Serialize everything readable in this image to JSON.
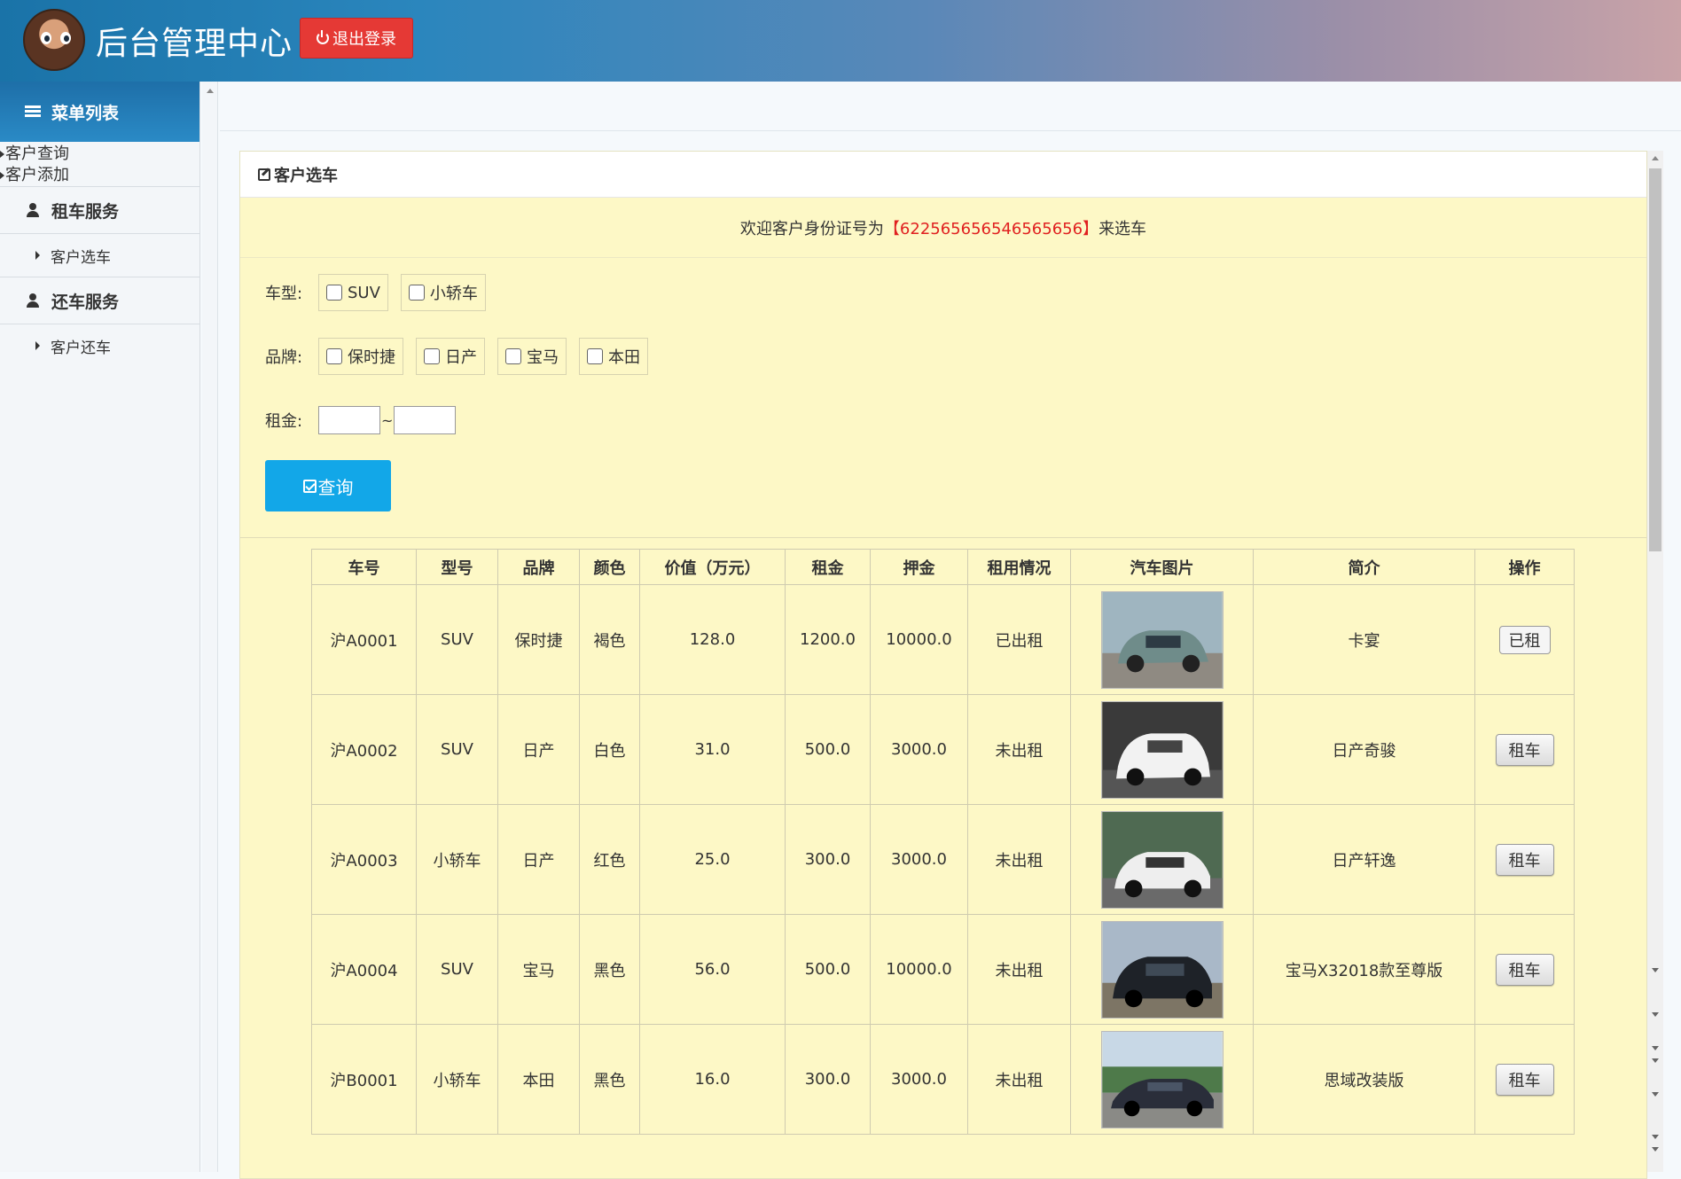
{
  "header": {
    "title": "后台管理中心",
    "logout_label": "退出登录"
  },
  "sidebar": {
    "menu_title": "菜单列表",
    "top_links": [
      "客户查询",
      "客户添加"
    ],
    "groups": [
      {
        "title": "租车服务",
        "items": [
          "客户选车"
        ]
      },
      {
        "title": "还车服务",
        "items": [
          "客户还车"
        ]
      }
    ]
  },
  "panel": {
    "title": "客户选车",
    "welcome_prefix": "欢迎客户身份证号为",
    "welcome_id": "【622565656546565656】",
    "welcome_suffix": "来选车"
  },
  "filters": {
    "type_label": "车型:",
    "types": [
      "SUV",
      "小轿车"
    ],
    "brand_label": "品牌:",
    "brands": [
      "保时捷",
      "日产",
      "宝马",
      "本田"
    ],
    "rent_label": "租金:",
    "rent_sep": "~",
    "query_label": "查询"
  },
  "table": {
    "headers": [
      "车号",
      "型号",
      "品牌",
      "颜色",
      "价值（万元）",
      "租金",
      "押金",
      "租用情况",
      "汽车图片",
      "简介",
      "操作"
    ],
    "rows": [
      {
        "no": "沪A0001",
        "model": "SUV",
        "brand": "保时捷",
        "color": "褐色",
        "value": "128.0",
        "rent": "1200.0",
        "deposit": "10000.0",
        "status": "已出租",
        "intro": "卡宴",
        "action": "已租"
      },
      {
        "no": "沪A0002",
        "model": "SUV",
        "brand": "日产",
        "color": "白色",
        "value": "31.0",
        "rent": "500.0",
        "deposit": "3000.0",
        "status": "未出租",
        "intro": "日产奇骏",
        "action": "租车"
      },
      {
        "no": "沪A0003",
        "model": "小轿车",
        "brand": "日产",
        "color": "红色",
        "value": "25.0",
        "rent": "300.0",
        "deposit": "3000.0",
        "status": "未出租",
        "intro": "日产轩逸",
        "action": "租车"
      },
      {
        "no": "沪A0004",
        "model": "SUV",
        "brand": "宝马",
        "color": "黑色",
        "value": "56.0",
        "rent": "500.0",
        "deposit": "10000.0",
        "status": "未出租",
        "intro": "宝马X32018款至尊版",
        "action": "租车"
      },
      {
        "no": "沪B0001",
        "model": "小轿车",
        "brand": "本田",
        "color": "黑色",
        "value": "16.0",
        "rent": "300.0",
        "deposit": "3000.0",
        "status": "未出租",
        "intro": "思域改装版",
        "action": "租车"
      }
    ]
  },
  "colors": {
    "header_start": "#1a73a8",
    "logout_red": "#e53935",
    "panel_bg": "#fdf8c6",
    "query_blue": "#12a7e8",
    "id_red": "#e02020"
  }
}
